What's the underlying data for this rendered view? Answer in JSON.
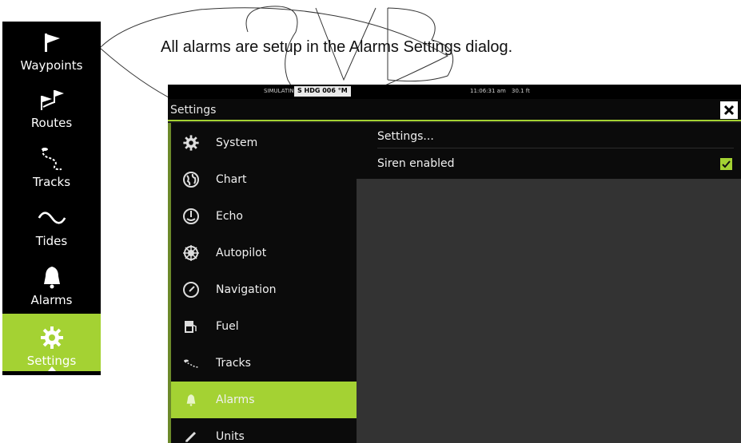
{
  "caption": "All alarms are setup in the Alarms Settings dialog.",
  "toolbar": {
    "items": [
      {
        "label": "Waypoints",
        "icon": "flag-icon"
      },
      {
        "label": "Routes",
        "icon": "route-flags-icon"
      },
      {
        "label": "Tracks",
        "icon": "track-icon"
      },
      {
        "label": "Tides",
        "icon": "wave-icon"
      },
      {
        "label": "Alarms",
        "icon": "bell-icon"
      },
      {
        "label": "Settings",
        "icon": "gear-icon",
        "active": true
      }
    ]
  },
  "statusbar": {
    "simulating": "SIMULATING...",
    "heading": "S HDG 006 °M",
    "time": "11:06:31 am",
    "depth": "30.1 ft"
  },
  "window": {
    "title": "Settings"
  },
  "menu": {
    "items": [
      {
        "label": "System",
        "icon": "gear-icon"
      },
      {
        "label": "Chart",
        "icon": "globe-icon"
      },
      {
        "label": "Echo",
        "icon": "echo-icon"
      },
      {
        "label": "Autopilot",
        "icon": "helm-icon"
      },
      {
        "label": "Navigation",
        "icon": "compass-icon"
      },
      {
        "label": "Fuel",
        "icon": "fuel-icon"
      },
      {
        "label": "Tracks",
        "icon": "track-icon"
      },
      {
        "label": "Alarms",
        "icon": "bell-icon",
        "active": true
      },
      {
        "label": "Units",
        "icon": "pencil-icon"
      }
    ]
  },
  "alarms_panel": {
    "settings_label": "Settings...",
    "siren_label": "Siren enabled",
    "siren_enabled": true
  },
  "colors": {
    "accent": "#a4d233",
    "window_bg": "#1a1a1a",
    "panel_bg": "#333333"
  }
}
